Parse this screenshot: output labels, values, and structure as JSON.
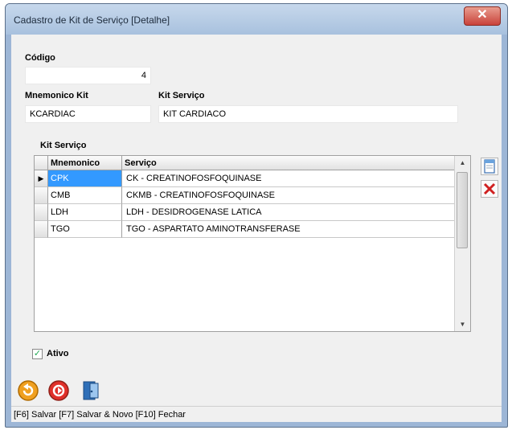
{
  "window": {
    "title": "Cadastro de Kit de Serviço [Detalhe]",
    "close_glyph": "✕"
  },
  "form": {
    "codigo_label": "Código",
    "codigo_value": "4",
    "mnemonico_label": "Mnemonico Kit",
    "mnemonico_value": "KCARDIAC",
    "kit_servico_label": "Kit Serviço",
    "kit_servico_value": "KIT CARDIACO",
    "grid_label": "Kit Serviço",
    "ativo_label": "Ativo",
    "ativo_checked": true
  },
  "grid": {
    "columns": [
      "Mnemonico",
      "Serviço"
    ],
    "rows": [
      {
        "mnemonico": "CPK",
        "servico": "CK - CREATINOFOSFOQUINASE",
        "selected": true
      },
      {
        "mnemonico": "CMB",
        "servico": "CKMB - CREATINOFOSFOQUINASE",
        "selected": false
      },
      {
        "mnemonico": "LDH",
        "servico": "LDH - DESIDROGENASE LATICA",
        "selected": false
      },
      {
        "mnemonico": "TGO",
        "servico": "TGO - ASPARTATO AMINOTRANSFERASE",
        "selected": false
      }
    ]
  },
  "icons": [
    "new-document-icon",
    "delete-icon",
    "save-icon",
    "save-new-icon",
    "exit-door-icon"
  ],
  "statusbar": {
    "text": "[F6] Salvar [F7] Salvar & Novo [F10] Fechar"
  }
}
